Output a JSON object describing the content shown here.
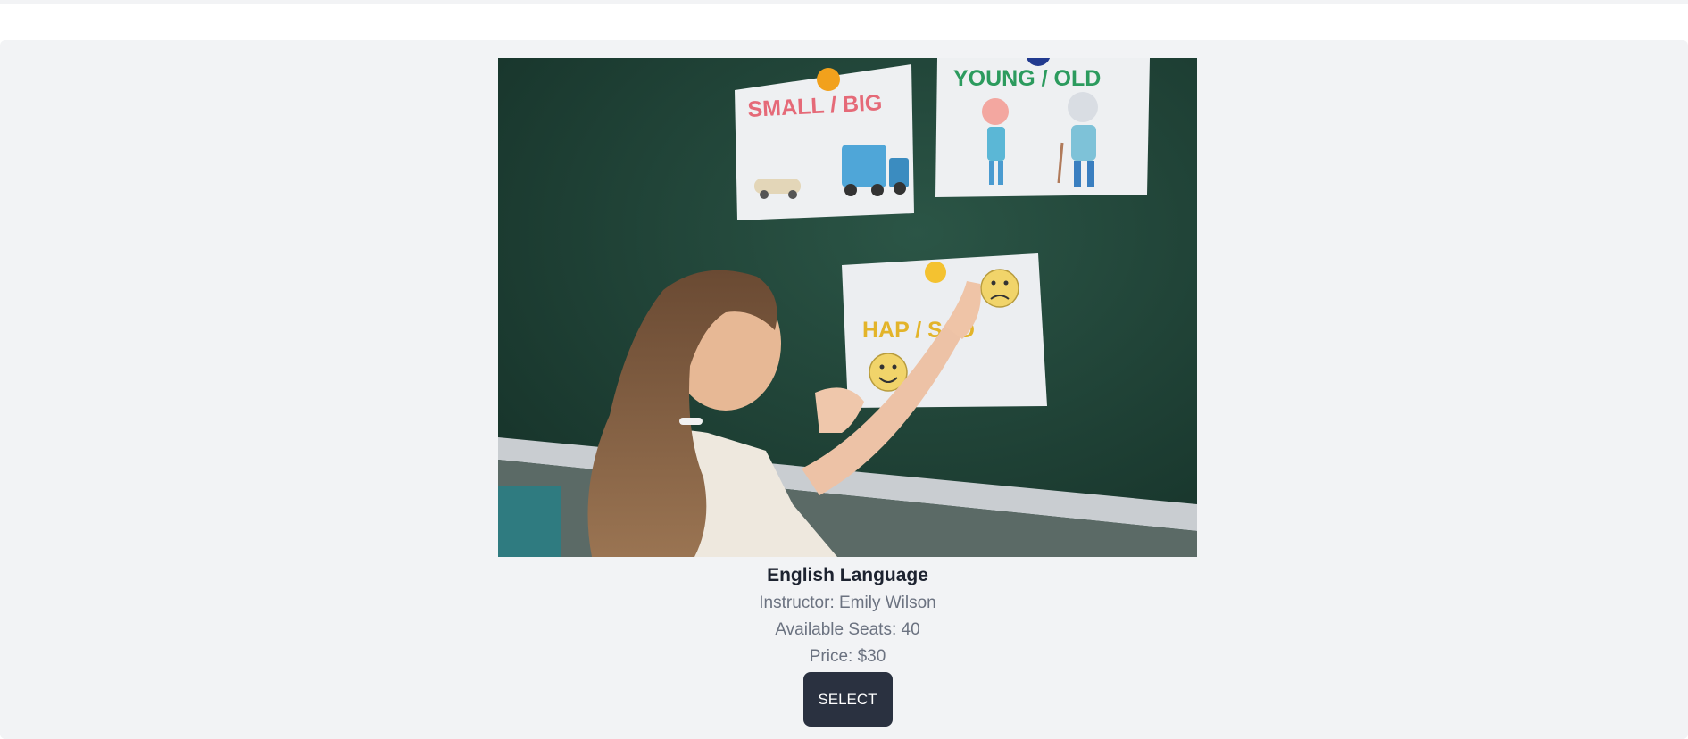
{
  "course": {
    "photo_alt": "Girl placing cards on a chalkboard",
    "cards": {
      "small_big": "SMALL / BIG",
      "young_old": "YOUNG / OLD",
      "happy_sad": "HAP     / SAD"
    },
    "title": "English Language",
    "instructor": "Instructor: Emily Wilson",
    "seats": "Available Seats: 40",
    "price": "Price: $30",
    "select_label": "SELECT"
  }
}
